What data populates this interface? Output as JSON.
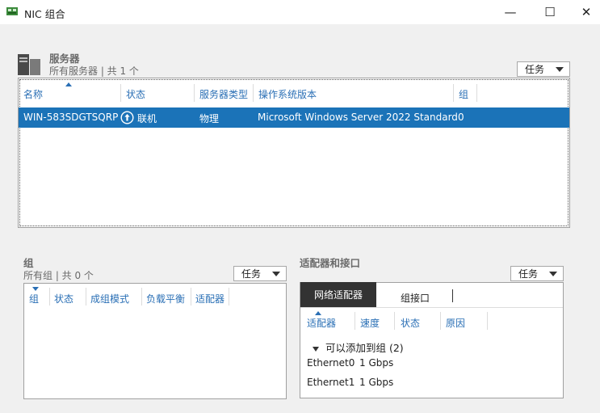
{
  "window": {
    "title": "NIC 组合",
    "minimize": "—",
    "maximize": "☐",
    "close": "✕"
  },
  "servers": {
    "title": "服务器",
    "subtitle": "所有服务器 | 共 1 个",
    "task_label": "任务",
    "columns": [
      "名称",
      "状态",
      "服务器类型",
      "操作系统版本",
      "组"
    ],
    "rows": [
      {
        "name": "WIN-583SDGTSQRP",
        "status": "联机",
        "type": "物理",
        "os": "Microsoft Windows Server 2022 Standard",
        "groups": "0"
      }
    ]
  },
  "groups": {
    "title": "组",
    "subtitle": "所有组 | 共 0 个",
    "task_label": "任务",
    "columns": [
      "组",
      "状态",
      "成组模式",
      "负载平衡",
      "适配器"
    ]
  },
  "adapters": {
    "title": "适配器和接口",
    "task_label": "任务",
    "tabs": [
      "网络适配器",
      "组接口"
    ],
    "columns": [
      "适配器",
      "速度",
      "状态",
      "原因"
    ],
    "group_header": "可以添加到组 (2)",
    "rows": [
      {
        "name": "Ethernet0",
        "speed": "1 Gbps"
      },
      {
        "name": "Ethernet1",
        "speed": "1 Gbps"
      }
    ]
  },
  "colors": {
    "accent": "#1b73b8",
    "header_text": "#2a6fb5",
    "tab_active": "#333333"
  }
}
